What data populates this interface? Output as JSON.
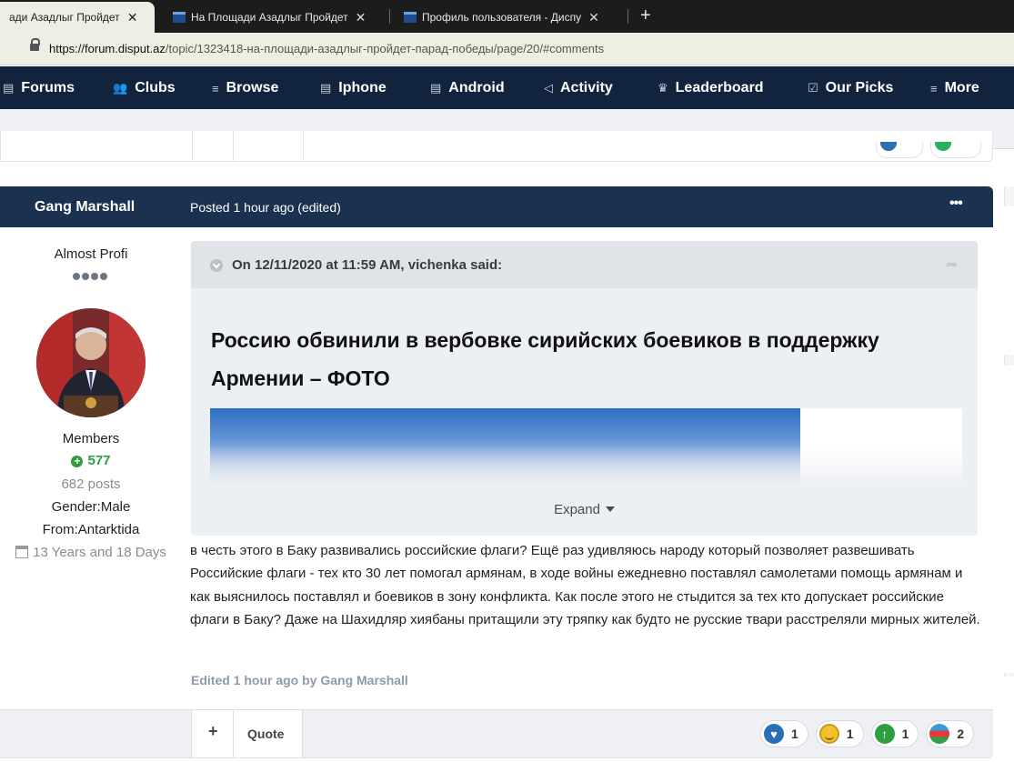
{
  "browser": {
    "tabs": [
      {
        "label": "ади Азадлыг Пройдет ",
        "active": true
      },
      {
        "label": "На Площади Азадлыг Пройдет ",
        "active": false
      },
      {
        "label": "Профиль пользователя - Диспу",
        "active": false
      }
    ],
    "close_glyph": "✕",
    "new_tab_glyph": "+",
    "address": {
      "domain": "https://forum.disput.az",
      "path": "/topic/1323418-на-площади-азадлыг-пройдет-парад-победы/page/20/#comments"
    }
  },
  "site_nav": {
    "items": [
      {
        "label": "Forums",
        "icon": "document-icon",
        "glyph": "▤"
      },
      {
        "label": "Clubs",
        "icon": "users-icon",
        "glyph": "👥"
      },
      {
        "label": "Browse",
        "icon": "list-icon",
        "glyph": "≡"
      },
      {
        "label": "Iphone",
        "icon": "document-icon",
        "glyph": "▤"
      },
      {
        "label": "Android",
        "icon": "document-icon",
        "glyph": "▤"
      },
      {
        "label": "Activity",
        "icon": "megaphone-icon",
        "glyph": "◁"
      },
      {
        "label": "Leaderboard",
        "icon": "trophy-icon",
        "glyph": "♛"
      },
      {
        "label": "Our Picks",
        "icon": "checkbox-icon",
        "glyph": "☑"
      },
      {
        "label": "More",
        "icon": "menu-icon",
        "glyph": "≡"
      }
    ]
  },
  "post": {
    "author": "Gang Marshall",
    "posted": "Posted 1 hour ago (edited)",
    "menu_glyph": "•••",
    "author_info": {
      "rank": "Almost Profi",
      "group": "Members",
      "reputation": "577",
      "posts": "682 posts",
      "gender": "Gender:Male",
      "from": "From:Antarktida",
      "member_since": "13 Years and 18 Days"
    },
    "quote": {
      "citation": "On 12/11/2020 at 11:59 AM, vichenka said:",
      "title": "Россию обвинили в вербовке сирийских боевиков в поддержку Армении – ФОТО",
      "expand_label": "Expand",
      "share_glyph": "➦"
    },
    "body": "в честь этого в Баку развивались российские флаги? Ещё раз удивляюсь народу который позволяет развешивать Российские флаги - тех кто 30 лет помогал армянам, в ходе войны ежедневно поставлял самолетами помощь армянам и как выяснилось поставлял и боевиков в зону конфликта. Как после этого не стыдится за тех кто допускает российские флаги в Баку? Даже на Шахидляр хиябаны притащили эту тряпку как будто не русские твари расстреляли мирных жителей.",
    "edited": "Edited 1 hour ago by Gang Marshall",
    "footer": {
      "plus_label": "+",
      "quote_label": "Quote"
    },
    "reactions": [
      {
        "icon": "heart-reaction-icon",
        "count": "1"
      },
      {
        "icon": "smile-reaction-icon",
        "count": "1"
      },
      {
        "icon": "upvote-reaction-icon",
        "count": "1"
      },
      {
        "icon": "azerbaijan-flag-reaction-icon",
        "count": "2"
      }
    ]
  },
  "colors": {
    "nav_bg": "#12243d",
    "post_header_bg": "#1a3150",
    "reputation_green": "#2e9e3e",
    "tab_strip_bg": "#1c1c1c"
  }
}
